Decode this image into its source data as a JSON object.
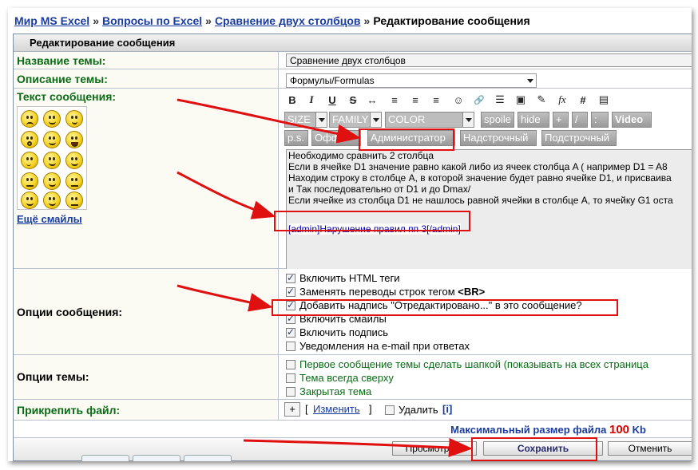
{
  "breadcrumb": {
    "items": [
      "Мир MS Excel",
      "Вопросы по Excel",
      "Сравнение двух столбцов"
    ],
    "current": "Редактирование сообщения",
    "separator": "»"
  },
  "form": {
    "header": "Редактирование сообщения",
    "topic_title_label": "Название темы:",
    "topic_title_value": "Сравнение двух столбцов",
    "topic_desc_label": "Описание темы:",
    "topic_desc_value": "Формулы/Formulas",
    "message_label": "Текст сообщения:",
    "more_smiles": "Ещё смайлы",
    "toolbar": {
      "icons": [
        "B",
        "I",
        "U",
        "S",
        "↔",
        "≡",
        "≡",
        "≡",
        "☺",
        "🔗",
        "☰",
        "▣",
        "✎",
        "fx",
        "#",
        "▤"
      ],
      "size": "SIZE",
      "family": "FAMILY",
      "color": "COLOR",
      "spoiler": "spoile",
      "hide": "hide",
      "plus": "+",
      "slash": "/",
      "colon": ":",
      "video": "Video",
      "ps": "p.s.",
      "offtop": "Оффт",
      "admin": "Администратор",
      "superscript": "Надстрочный",
      "subscript": "Подстрочный"
    },
    "message_lines": [
      "Необходимо сравнить 2 столбца",
      "Если в ячейке D1 значение равно какой либо из ячеек столбца A ( например D1 = A8",
      "Находим строку в столбце A, в которой значение будет равно ячейке D1, и присваива",
      "и Так последовательно от D1 и до Dmax/",
      "Если ячейке из столбца D1 не нашлось равной ячейки в столбце A, то ячейку G1 оста",
      ""
    ],
    "admin_tag": "[admin]Нарушение правил пп 3[/admin]",
    "post_options_label": "Опции сообщения:",
    "post_options": [
      {
        "label": "Включить HTML теги",
        "checked": true
      },
      {
        "label": "Заменять переводы строк тегом ",
        "bold": "<BR>",
        "checked": true
      },
      {
        "label": "Добавить надпись \"Отредактировано...\" в это сообщение?",
        "checked": true
      },
      {
        "label": "Включить смайлы",
        "checked": true
      },
      {
        "label": "Включить подпись",
        "checked": true
      },
      {
        "label": "Уведомления на e-mail при ответах",
        "checked": false
      }
    ],
    "topic_options_label": "Опции темы:",
    "topic_options": [
      {
        "label": "Первое сообщение темы сделать шапкой (показывать на всех страница",
        "checked": false
      },
      {
        "label": "Тема всегда сверху",
        "checked": false
      },
      {
        "label": "Закрытая тема",
        "checked": false
      }
    ],
    "attach_label": "Прикрепить файл:",
    "attach_plus": "+",
    "attach_change": "Изменить",
    "attach_delete": "Удалить",
    "attach_info": "i",
    "max_size_text": "Максимальный размер файла",
    "max_size_value": "100",
    "max_size_unit": "Kb",
    "preview_button": "Просмотреть",
    "save_button": "Сохранить",
    "cancel_button": "Отменить"
  },
  "colors": {
    "link": "#1a3c9f",
    "label_green": "#0b6b16",
    "highlight_red": "#e01010"
  }
}
